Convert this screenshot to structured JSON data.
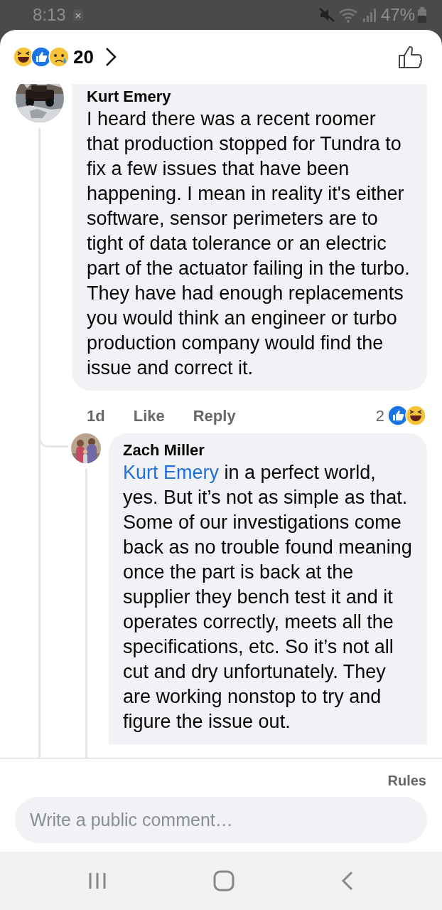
{
  "status_bar": {
    "time": "8:13",
    "battery": "47%"
  },
  "header": {
    "reaction_count": "20"
  },
  "comments": [
    {
      "author": "Kurt Emery",
      "text": "I heard there was a recent roomer that production stopped for Tundra to fix a few issues that have been happening. I mean in reality it's either software, sensor perimeters are to tight of data tolerance or an electric part of the actuator failing in the turbo. They have had enough replacements you would think an engineer or turbo production company would find the issue and correct it.",
      "time": "1d",
      "actions": [
        "Like",
        "Reply"
      ],
      "reaction_count": "2",
      "replies": [
        {
          "author": "Zach Miller",
          "mention": "Kurt Emery",
          "text": "in a perfect world, yes. But it’s not as simple as that. Some of our investigations come back as no trouble found meaning once the part is back at the supplier they bench test it and it operates correctly, meets all the specifications, etc. So it’s not all cut and dry unfortunately. They are working nonstop to try and figure the issue out."
        }
      ]
    }
  ],
  "composer": {
    "rules": "Rules",
    "placeholder": "Write a public comment…"
  }
}
